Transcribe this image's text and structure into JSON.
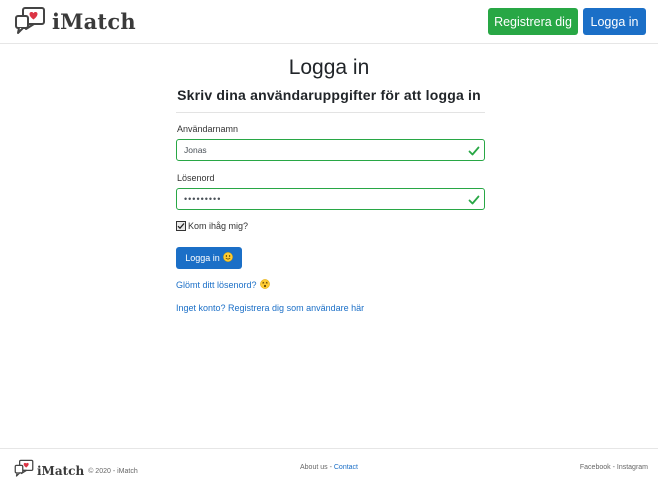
{
  "brand": {
    "name": "iMatch"
  },
  "nav": {
    "register_label": "Registrera dig",
    "login_label": "Logga in"
  },
  "main": {
    "title": "Logga in",
    "subtitle": "Skriv dina användaruppgifter för att logga in",
    "username": {
      "label": "Användarnamn",
      "value": "Jonas"
    },
    "password": {
      "label": "Lösenord",
      "value": "•••••••••"
    },
    "remember": {
      "label": "Kom ihåg mig?",
      "checked": true
    },
    "submit_label": "Logga in",
    "forgot_link": "Glömt ditt lösenord?",
    "register_link": "Inget konto? Registrera dig som användare här"
  },
  "footer": {
    "brand": "iMatch",
    "copyright": "© 2020 - iMatch",
    "about": "About us",
    "separator": " - ",
    "contact": "Contact",
    "facebook": "Facebook",
    "instagram": "Instagram"
  },
  "icons": {
    "logo": "chat-bubbles-heart-icon",
    "valid": "checkmark-icon",
    "submit_emoji": "smiling-face-icon",
    "forgot_emoji": "dizzy-face-icon"
  },
  "colors": {
    "primary": "#1b6fc7",
    "success": "#28a745",
    "heart": "#dc3545"
  }
}
